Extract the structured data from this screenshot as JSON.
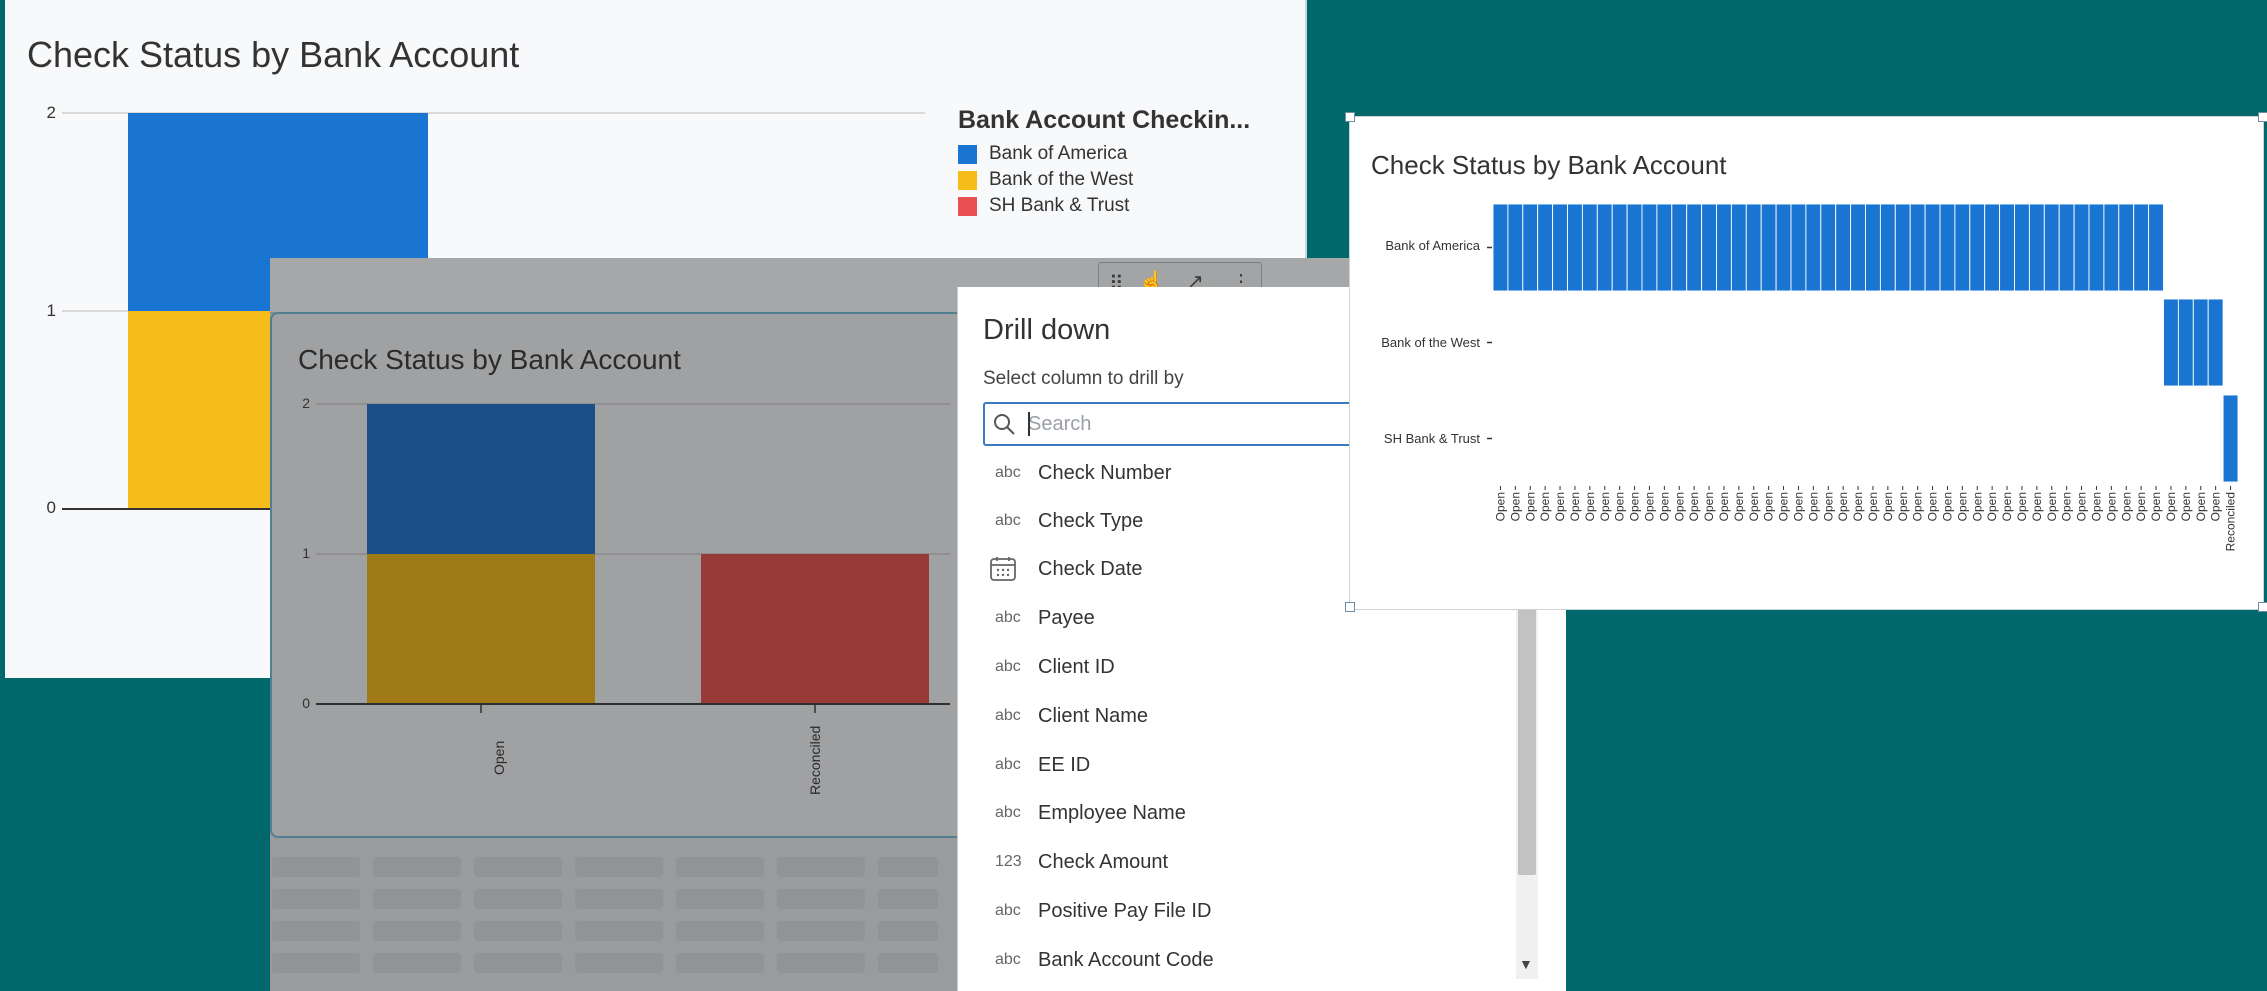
{
  "panel_back": {
    "title": "Check Status by Bank Account",
    "legend_title": "Bank Account Checkin...",
    "legend": [
      {
        "label": "Bank of America",
        "color": "#1a75d2"
      },
      {
        "label": "Bank of the West",
        "color": "#f6bd1a"
      },
      {
        "label": "SH Bank & Trust",
        "color": "#ea5051"
      }
    ],
    "yticks": [
      "2",
      "1",
      "0"
    ]
  },
  "panel_mid": {
    "title": "Check Status by Bank Account",
    "yticks": [
      "2",
      "1",
      "0"
    ],
    "xticks": [
      "Open",
      "Reconciled"
    ]
  },
  "drilldown": {
    "title": "Drill down",
    "subtitle": "Select column to drill by",
    "search_placeholder": "Search",
    "items": [
      {
        "type": "abc",
        "label": "Check Number"
      },
      {
        "type": "abc",
        "label": "Check Type"
      },
      {
        "type": "calendar-icon",
        "label": "Check Date"
      },
      {
        "type": "abc",
        "label": "Payee"
      },
      {
        "type": "abc",
        "label": "Client ID"
      },
      {
        "type": "abc",
        "label": "Client Name"
      },
      {
        "type": "abc",
        "label": "EE ID"
      },
      {
        "type": "abc",
        "label": "Employee Name"
      },
      {
        "type": "123",
        "label": "Check Amount"
      },
      {
        "type": "abc",
        "label": "Positive Pay File ID"
      },
      {
        "type": "abc",
        "label": "Bank Account Code"
      }
    ]
  },
  "panel_right": {
    "title": "Check Status by Bank Account",
    "rows": [
      "Bank of America",
      "Bank of the West",
      "SH Bank & Trust"
    ],
    "xtick_open": "Open",
    "xtick_reconciled": "Reconciled"
  },
  "chart_data": [
    {
      "type": "bar",
      "title": "Check Status by Bank Account",
      "stacked": true,
      "categories": [
        "Open"
      ],
      "series": [
        {
          "name": "Bank of America",
          "values": [
            1
          ]
        },
        {
          "name": "Bank of the West",
          "values": [
            1
          ]
        },
        {
          "name": "SH Bank & Trust",
          "values": [
            0
          ]
        }
      ],
      "ylim": [
        0,
        2
      ],
      "legend_position": "right",
      "colors": [
        "#1a75d2",
        "#f6bd1a",
        "#ea5051"
      ]
    },
    {
      "type": "bar",
      "title": "Check Status by Bank Account",
      "stacked": true,
      "categories": [
        "Open",
        "Reconciled"
      ],
      "series": [
        {
          "name": "Bank of America",
          "values": [
            1,
            0
          ]
        },
        {
          "name": "Bank of the West",
          "values": [
            1,
            0
          ]
        },
        {
          "name": "SH Bank & Trust",
          "values": [
            0,
            1
          ]
        }
      ],
      "ylim": [
        0,
        2
      ],
      "colors": [
        "#1b4f87",
        "#a07a17",
        "#973a38"
      ]
    },
    {
      "type": "heatmap",
      "title": "Check Status by Bank Account",
      "rows": [
        "Bank of America",
        "Bank of the West",
        "SH Bank & Trust"
      ],
      "row_counts": [
        45,
        4,
        1
      ],
      "row_status": [
        "Open",
        "Open",
        "Reconciled"
      ],
      "color": "#1a75d2"
    }
  ]
}
